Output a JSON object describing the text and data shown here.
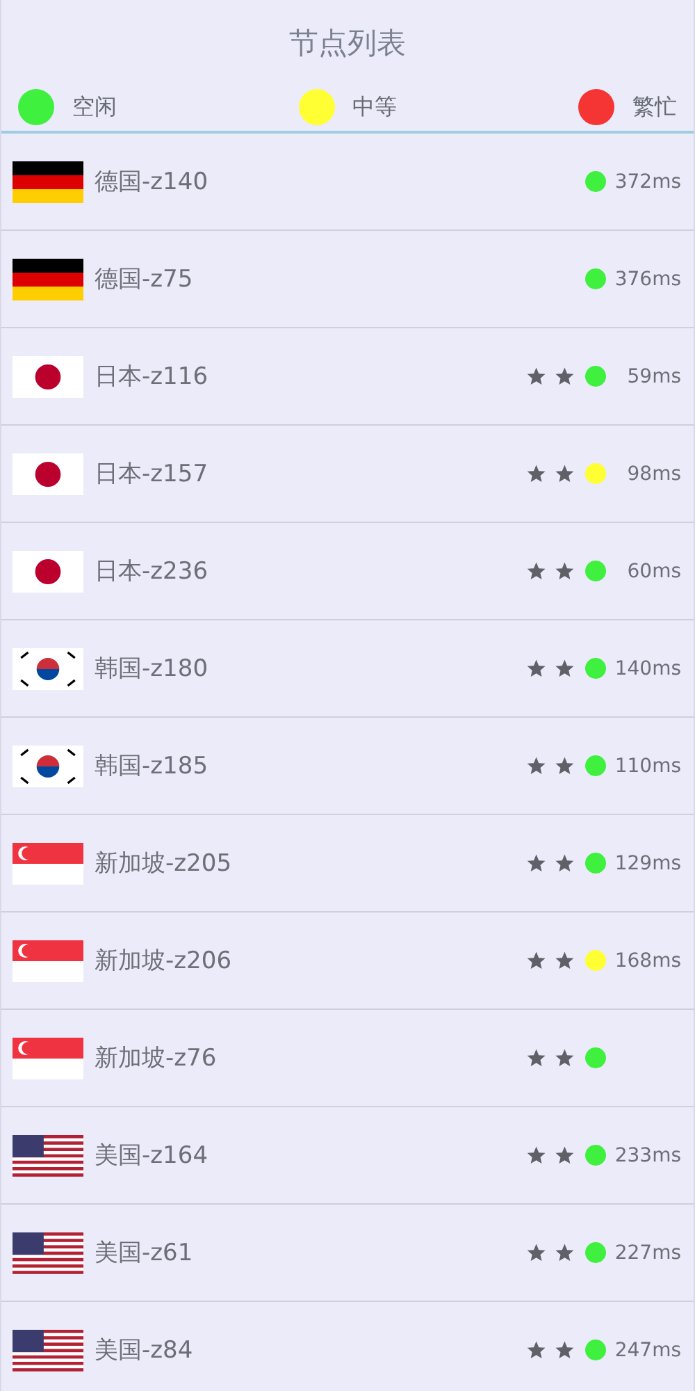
{
  "title": "节点列表",
  "legend": [
    {
      "label": "空闲",
      "color": "#3ff03f"
    },
    {
      "label": "中等",
      "color": "#ffff33"
    },
    {
      "label": "繁忙",
      "color": "#f53434"
    }
  ],
  "nodes": [
    {
      "kind": "de",
      "name": "德国-z140",
      "starred": false,
      "color": "#3ff03f",
      "latency": "372ms"
    },
    {
      "kind": "de",
      "name": "德国-z75",
      "starred": false,
      "color": "#3ff03f",
      "latency": "376ms"
    },
    {
      "kind": "jp",
      "name": "日本-z116",
      "starred": true,
      "color": "#3ff03f",
      "latency": "59ms"
    },
    {
      "kind": "jp",
      "name": "日本-z157",
      "starred": true,
      "color": "#ffff33",
      "latency": "98ms"
    },
    {
      "kind": "jp",
      "name": "日本-z236",
      "starred": true,
      "color": "#3ff03f",
      "latency": "60ms"
    },
    {
      "kind": "kr",
      "name": "韩国-z180",
      "starred": true,
      "color": "#3ff03f",
      "latency": "140ms"
    },
    {
      "kind": "kr",
      "name": "韩国-z185",
      "starred": true,
      "color": "#3ff03f",
      "latency": "110ms"
    },
    {
      "kind": "sg",
      "name": "新加坡-z205",
      "starred": true,
      "color": "#3ff03f",
      "latency": "129ms"
    },
    {
      "kind": "sg",
      "name": "新加坡-z206",
      "starred": true,
      "color": "#ffff33",
      "latency": "168ms"
    },
    {
      "kind": "sg",
      "name": "新加坡-z76",
      "starred": true,
      "color": "#3ff03f"
    },
    {
      "kind": "us",
      "name": "美国-z164",
      "starred": true,
      "color": "#3ff03f",
      "latency": "233ms"
    },
    {
      "kind": "us",
      "name": "美国-z61",
      "starred": true,
      "color": "#3ff03f",
      "latency": "227ms"
    },
    {
      "kind": "us",
      "name": "美国-z84",
      "starred": true,
      "color": "#3ff03f",
      "latency": "247ms"
    }
  ]
}
